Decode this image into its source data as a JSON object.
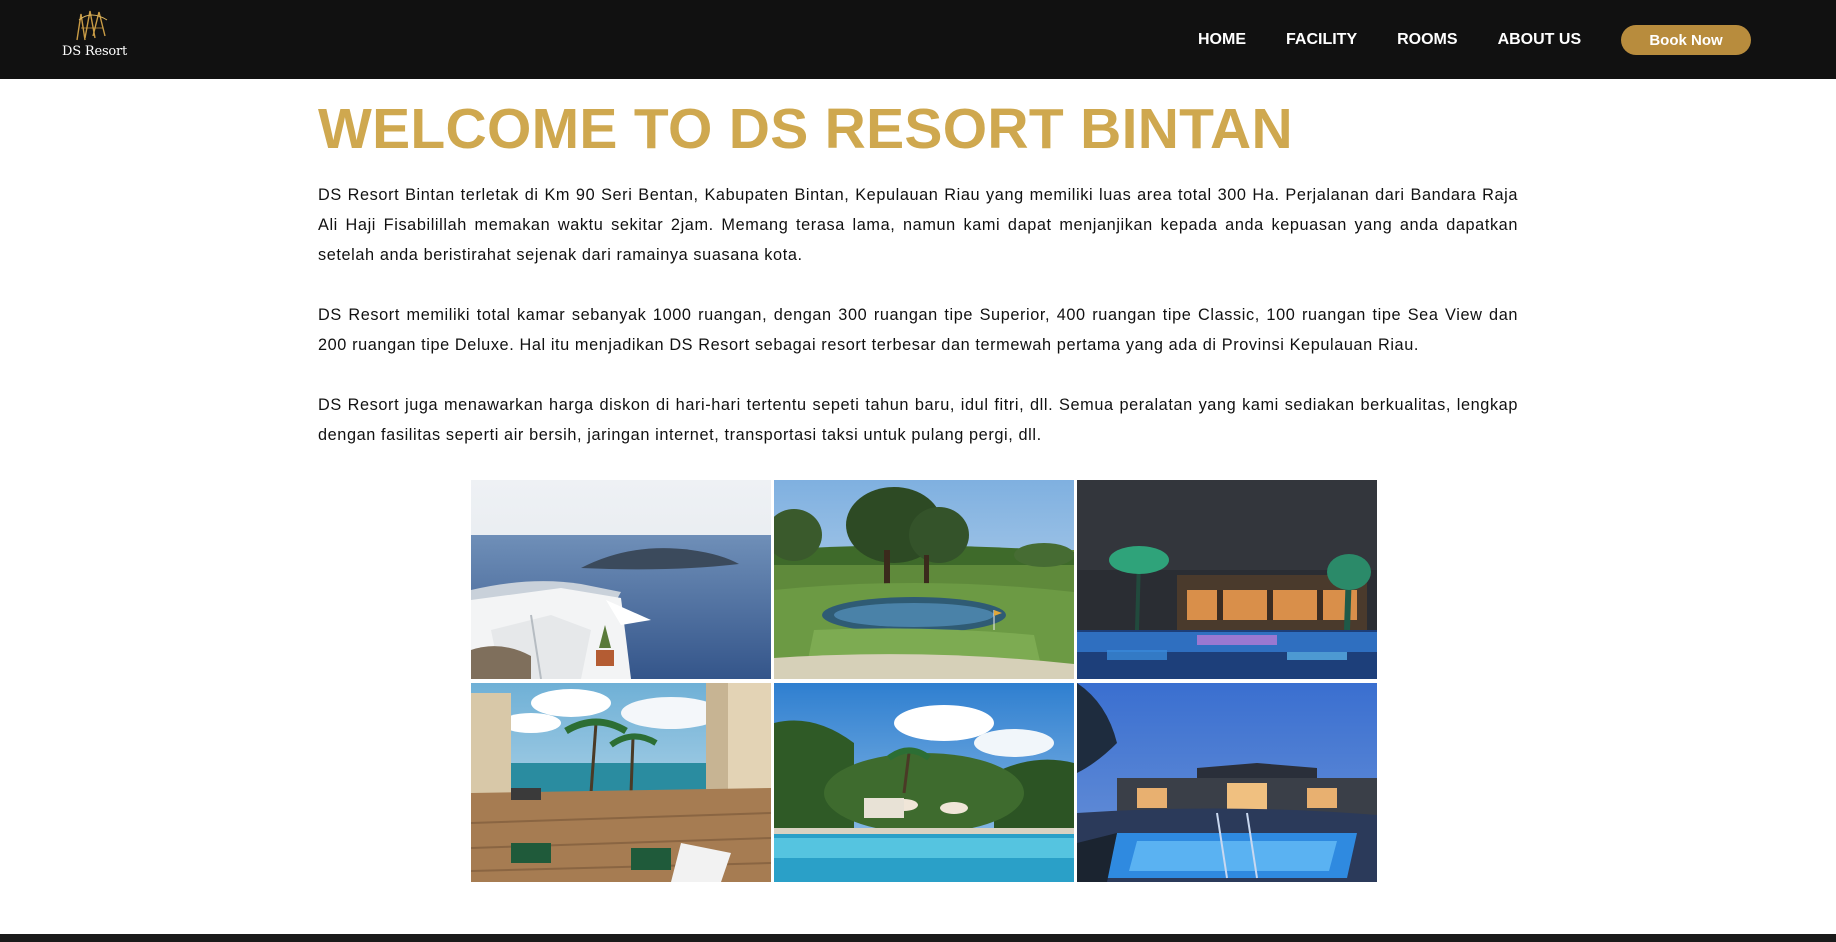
{
  "header": {
    "logo_text": "DS Resort",
    "nav": [
      "HOME",
      "FACILITY",
      "ROOMS",
      "ABOUT US"
    ],
    "book_label": "Book Now"
  },
  "main": {
    "title": "WELCOME TO DS RESORT BINTAN",
    "paragraphs": [
      "DS Resort Bintan terletak di Km 90 Seri Bentan, Kabupaten Bintan, Kepulauan Riau yang memiliki luas area total 300 Ha. Perjalanan dari Bandara Raja Ali Haji Fisabilillah memakan waktu sekitar 2jam. Memang terasa lama, namun kami dapat menjanjikan kepada anda kepuasan yang anda dapatkan setelah anda beristirahat sejenak dari ramainya suasana kota.",
      "DS Resort memiliki total kamar sebanyak 1000 ruangan, dengan 300 ruangan tipe Superior, 400 ruangan tipe Classic, 100 ruangan tipe Sea View dan 200 ruangan tipe Deluxe. Hal itu menjadikan DS Resort sebagai resort terbesar dan termewah pertama yang ada di Provinsi Kepulauan Riau.",
      "DS Resort juga menawarkan harga diskon di hari-hari tertentu sepeti tahun baru, idul fitri, dll. Semua peralatan yang kami sediakan berkualitas, lengkap dengan fasilitas seperti air bersih, jaringan internet, transportasi taksi untuk pulang pergi, dll."
    ]
  },
  "colors": {
    "header_bg": "#111111",
    "title_gold": "#cfa84f",
    "button_gold": "#b88c3d"
  }
}
